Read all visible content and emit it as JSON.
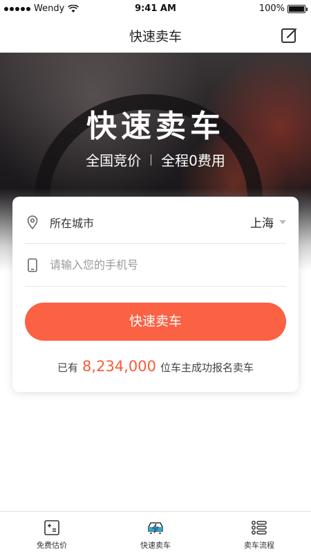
{
  "status_bar": {
    "carrier": "Wendy",
    "time": "9:41 AM",
    "battery": "100%"
  },
  "nav": {
    "title": "快速卖车",
    "edit_icon": "edit-icon"
  },
  "hero": {
    "title": "快速卖车",
    "sub_left": "全国竞价",
    "sub_right": "全程0费用"
  },
  "form": {
    "city_label": "所在城市",
    "city_value": "上海",
    "phone_placeholder": "请输入您的手机号",
    "submit_label": "快速卖车",
    "count_prefix": "已有",
    "count_value": "8,234,000",
    "count_suffix": "位车主成功报名卖车"
  },
  "tabs": [
    {
      "label": "免费估价",
      "icon": "calculator-icon"
    },
    {
      "label": "快速卖车",
      "icon": "car-lightning-icon"
    },
    {
      "label": "卖车流程",
      "icon": "list-icon"
    }
  ],
  "colors": {
    "accent": "#fb6143",
    "count_color": "#fb5a3a",
    "tab_active_icon": "#2aa8d8"
  }
}
